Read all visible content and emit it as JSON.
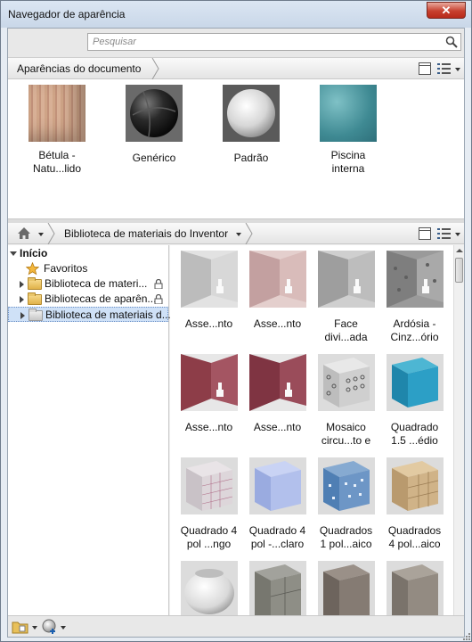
{
  "window": {
    "title": "Navegador de aparência",
    "close_glyph": "✕"
  },
  "search": {
    "placeholder": "Pesquisar"
  },
  "doc_crumb": {
    "label": "Aparências do documento"
  },
  "doc_materials": [
    {
      "label": "Bétula - Natu...lido",
      "line1": "Bétula -",
      "line2": "Natu...lido",
      "icon": "birch-cube"
    },
    {
      "label": "Genérico",
      "line1": "Genérico",
      "line2": "",
      "icon": "generic-sphere"
    },
    {
      "label": "Padrão",
      "line1": "Padrão",
      "line2": "",
      "icon": "default-sphere"
    },
    {
      "label": "Piscina interna",
      "line1": "Piscina",
      "line2": "interna",
      "icon": "pool-water"
    }
  ],
  "nav": {
    "library_label": "Biblioteca de materiais do Inventor"
  },
  "tree": {
    "root": "Início",
    "items": [
      {
        "label": "Favoritos",
        "icon": "star-icon"
      },
      {
        "label": "Biblioteca de materi...",
        "icon": "folder-icon",
        "locked": true
      },
      {
        "label": "Bibliotecas de aparên...",
        "icon": "folder-icon",
        "locked": true
      },
      {
        "label": "Biblioteca de materiais d...",
        "icon": "folder-icon",
        "selected": true
      }
    ]
  },
  "library_materials": [
    {
      "line1": "Asse...nto",
      "line2": "",
      "tex": "wall-white"
    },
    {
      "line1": "Asse...nto",
      "line2": "",
      "tex": "wall-pink"
    },
    {
      "line1": "Face",
      "line2": "divi...ada",
      "tex": "wall-gray"
    },
    {
      "line1": "Ardósia -",
      "line2": "Cinz...ório",
      "tex": "wall-slate"
    },
    {
      "line1": "Asse...nto",
      "line2": "",
      "tex": "wall-redbrick"
    },
    {
      "line1": "Asse...nto",
      "line2": "",
      "tex": "wall-redbrick"
    },
    {
      "line1": "Mosaico",
      "line2": "circu...to e",
      "tex": "mosaic-circles"
    },
    {
      "line1": "Quadrado",
      "line2": "1.5 ...édio",
      "tex": "tile-blue"
    },
    {
      "line1": "Quadrado 4",
      "line2": "pol ...ngo",
      "tex": "tile-checker"
    },
    {
      "line1": "Quadrado 4",
      "line2": "pol -...claro",
      "tex": "tile-lightblue"
    },
    {
      "line1": "Quadrados",
      "line2": "1 pol...aico",
      "tex": "tile-mosaicblue"
    },
    {
      "line1": "Quadrados",
      "line2": "4 pol...aico",
      "tex": "tile-beige"
    },
    {
      "line1": "",
      "line2": "",
      "tex": "white-bowl"
    },
    {
      "line1": "",
      "line2": "",
      "tex": "stone-gray"
    },
    {
      "line1": "",
      "line2": "",
      "tex": "stone-dark"
    },
    {
      "line1": "",
      "line2": "",
      "tex": "stone-mid"
    }
  ]
}
